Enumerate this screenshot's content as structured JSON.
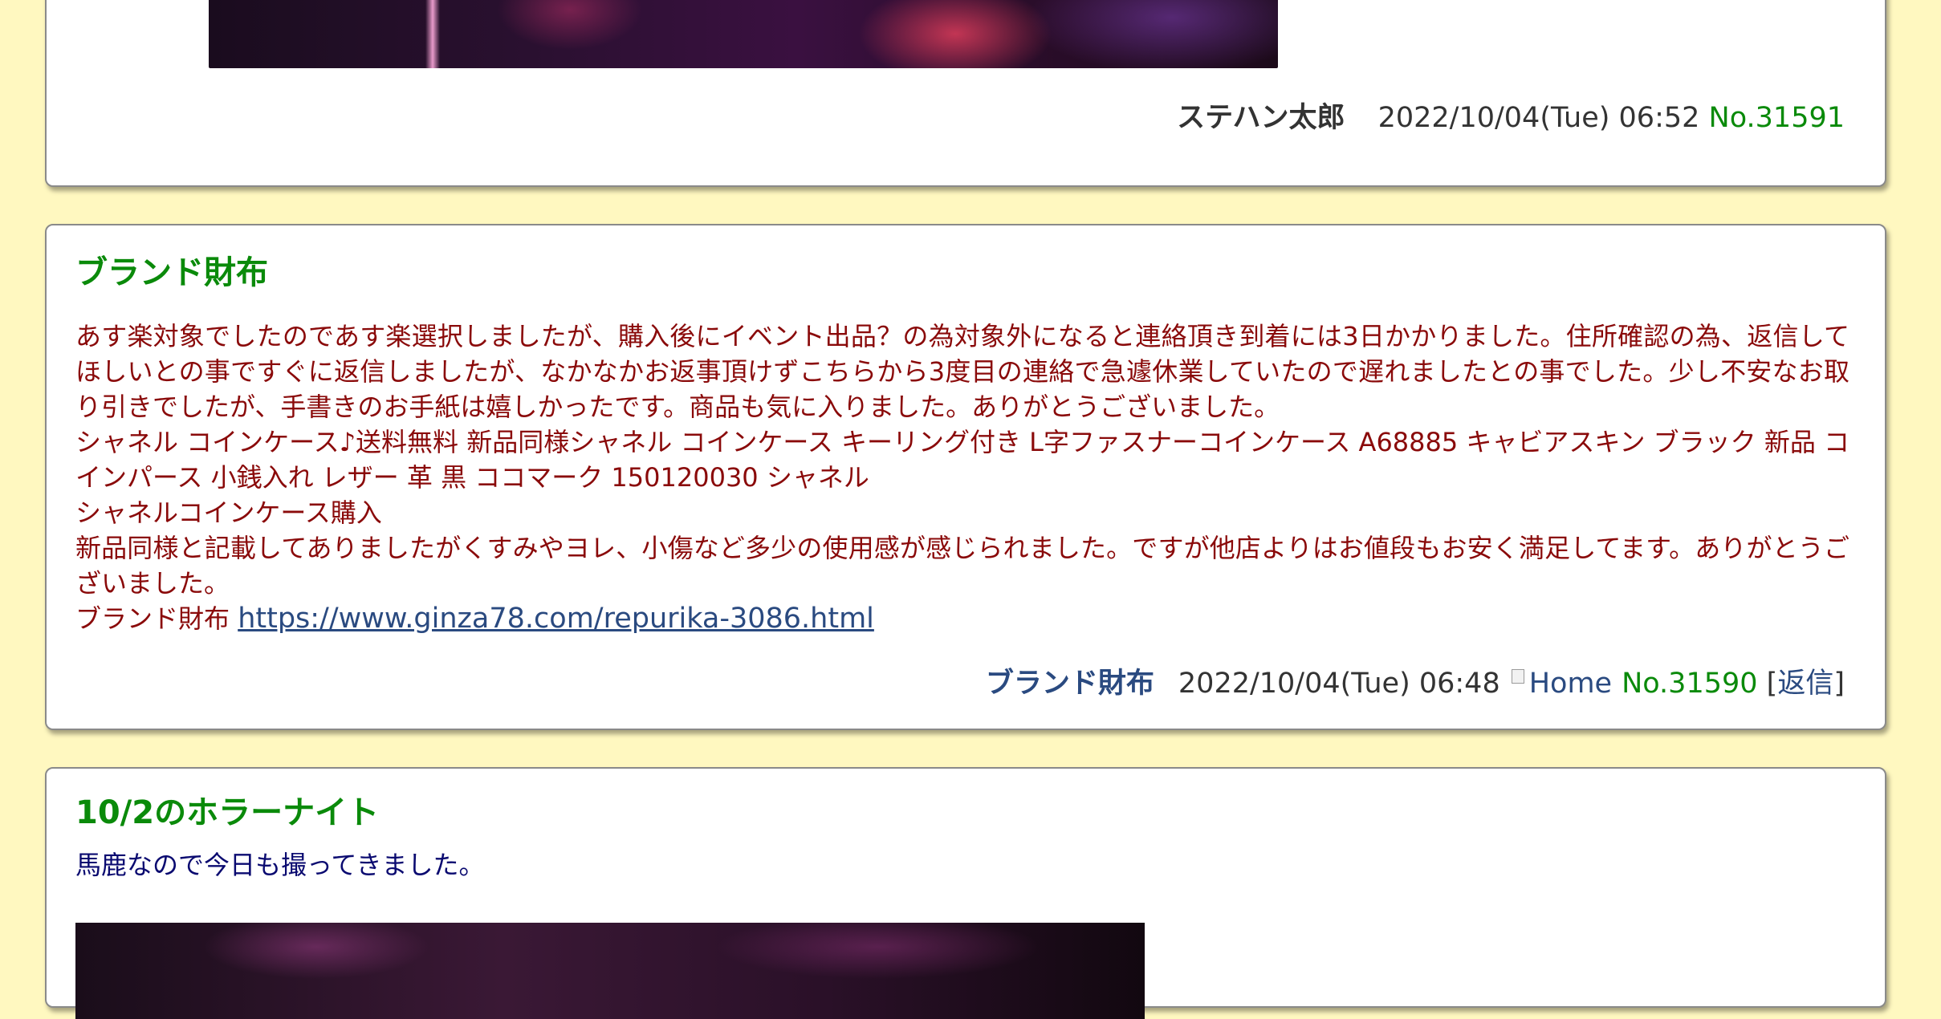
{
  "posts": [
    {
      "author": "ステハン太郎",
      "date": "2022/10/04(Tue) 06:52",
      "number": "No.31591"
    },
    {
      "title": "ブランド財布",
      "paragraphs": [
        "あす楽対象でしたのであす楽選択しましたが、購入後にイベント出品？の為対象外になると連絡頂き到着には3日かかりました。住所確認の為、返信してほしいとの事ですぐに返信しましたが、なかなかお返事頂けずこちらから3度目の連絡で急遽休業していたので遅れましたとの事でした。少し不安なお取り引きでしたが、手書きのお手紙は嬉しかったです。商品も気に入りました。ありがとうございました。",
        "シャネル コインケース♪送料無料 新品同様シャネル コインケース キーリング付き L字ファスナーコインケース A68885 キャビアスキン ブラック 新品 コインパース 小銭入れ レザー 革 黒 ココマーク 150120030 シャネル",
        "シャネルコインケース購入",
        "新品同様と記載してありましたがくすみやヨレ、小傷など多少の使用感が感じられました。ですが他店よりはお値段もお安く満足してます。ありがとうございました。"
      ],
      "link_prefix": "ブランド財布",
      "link_url": "https://www.ginza78.com/repurika-3086.html",
      "author": "ブランド財布",
      "date": "2022/10/04(Tue) 06:48",
      "home_alt": "Home",
      "number": "No.31590",
      "reply_label": "返信",
      "bracket_open": "[",
      "bracket_close": "]"
    },
    {
      "title": "10/2のホラーナイト",
      "body": "馬鹿なので今日も撮ってきました。"
    }
  ],
  "colors": {
    "background": "#fff8c0",
    "title": "#0a8a0a",
    "body_text": "#8a0a0a",
    "link": "#2a4a80",
    "number": "#0a8a0a"
  }
}
